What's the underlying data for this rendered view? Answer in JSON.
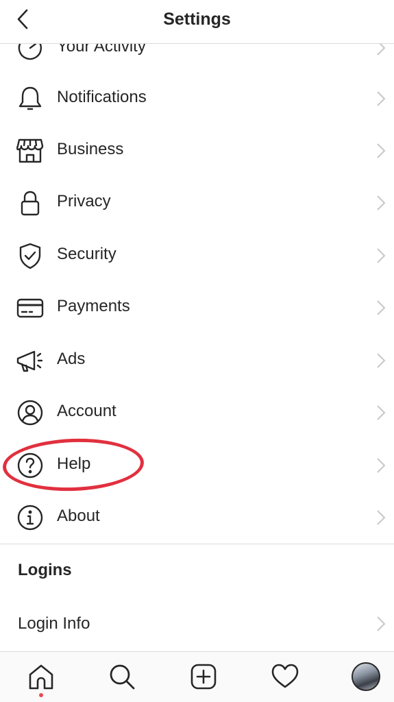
{
  "header": {
    "title": "Settings"
  },
  "menu": [
    {
      "label": "Your Activity",
      "icon": "activity-icon"
    },
    {
      "label": "Notifications",
      "icon": "bell-icon"
    },
    {
      "label": "Business",
      "icon": "shop-icon"
    },
    {
      "label": "Privacy",
      "icon": "lock-icon"
    },
    {
      "label": "Security",
      "icon": "shield-icon"
    },
    {
      "label": "Payments",
      "icon": "card-icon"
    },
    {
      "label": "Ads",
      "icon": "megaphone-icon"
    },
    {
      "label": "Account",
      "icon": "user-circle-icon"
    },
    {
      "label": "Help",
      "icon": "question-icon"
    },
    {
      "label": "About",
      "icon": "info-icon"
    }
  ],
  "logins": {
    "section_title": "Logins",
    "login_info": "Login Info"
  },
  "tabbar": [
    "home-icon",
    "search-icon",
    "new-post-icon",
    "heart-icon",
    "profile-avatar"
  ],
  "colors": {
    "accent_red": "#e1303f",
    "text": "#262626",
    "chevron": "#c7c7cc",
    "divider": "#dbdbdb"
  }
}
